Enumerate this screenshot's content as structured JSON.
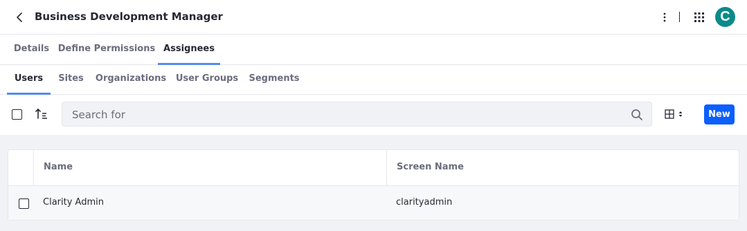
{
  "header": {
    "title": "Business Development Manager",
    "avatar_initial": "C",
    "avatar_color": "#0b8a8a"
  },
  "tabs_primary": [
    {
      "label": "Details",
      "active": false
    },
    {
      "label": "Define Permissions",
      "active": false
    },
    {
      "label": "Assignees",
      "active": true
    }
  ],
  "tabs_secondary": [
    {
      "label": "Users",
      "active": true
    },
    {
      "label": "Sites",
      "active": false
    },
    {
      "label": "Organizations",
      "active": false
    },
    {
      "label": "User Groups",
      "active": false
    },
    {
      "label": "Segments",
      "active": false
    }
  ],
  "toolbar": {
    "search_placeholder": "Search for",
    "new_label": "New"
  },
  "table": {
    "columns": [
      "Name",
      "Screen Name"
    ],
    "rows": [
      {
        "name": "Clarity Admin",
        "screen_name": "clarityadmin"
      }
    ]
  },
  "colors": {
    "primary": "#0b5fff",
    "tab_indicator": "#528cf0",
    "background": "#f1f2f5"
  }
}
